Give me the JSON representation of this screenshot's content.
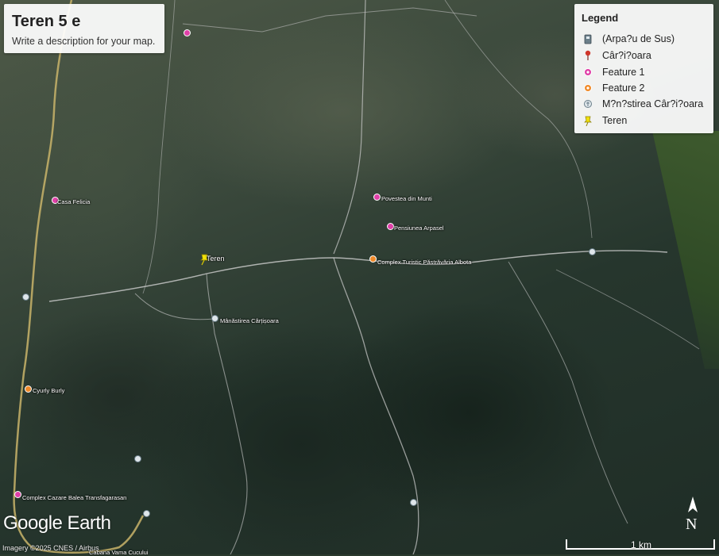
{
  "title_panel": {
    "title": "Teren 5 e",
    "description": "Write a description for your map."
  },
  "legend": {
    "title": "Legend",
    "items": [
      {
        "label": "(Arpa?u de Sus)",
        "icon": "building-icon",
        "color": "#6b7f8a"
      },
      {
        "label": "Câr?i?oara",
        "icon": "red-pin-icon",
        "color": "#d0362b"
      },
      {
        "label": "Feature 1",
        "icon": "magenta-circle-icon",
        "color": "#e040a8"
      },
      {
        "label": "Feature 2",
        "icon": "orange-circle-icon",
        "color": "#f08a2a"
      },
      {
        "label": "M?n?stirea Câr?i?oara",
        "icon": "church-icon",
        "color": "#8aa0b0"
      },
      {
        "label": "Teren",
        "icon": "yellow-pushpin-icon",
        "color": "#f2e10a"
      }
    ]
  },
  "map_labels": {
    "casa_felicia": "Casa Felicia",
    "povestea": "Povestea din Munti",
    "pensiunea": "Pensiunea Arpasel",
    "complex_albota": "Complex Turistic Păstrăvăria Albota",
    "teren": "Teren",
    "manastirea": "Mânăstirea Cârțișoara",
    "cyurly": "Cyurly Burly",
    "balea": "Complex Cazare Balea Transfagarasan",
    "cabana": "Cabana Vama Cucului"
  },
  "branding": {
    "logo": "Google Earth",
    "imagery": "Imagery ©2025 CNES / Airbus"
  },
  "compass": {
    "letter": "N"
  },
  "scale": {
    "label": "1 km"
  }
}
